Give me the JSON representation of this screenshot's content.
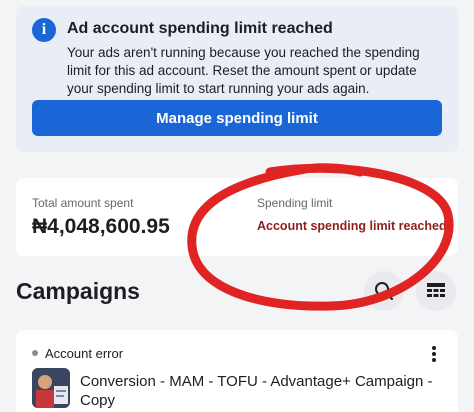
{
  "alert": {
    "title": "Ad account spending limit reached",
    "body": "Your ads aren't running because you reached the spending limit for this ad account. Reset the amount spent or update your spending limit to start running your ads again.",
    "button_label": "Manage spending limit",
    "icon": "info-icon",
    "accent_color": "#1b66d6"
  },
  "summary": {
    "total_label": "Total amount spent",
    "total_value": "₦4,048,600.95",
    "limit_label": "Spending limit",
    "limit_value": "Account spending limit reached",
    "limit_value_color": "#8e1e1e"
  },
  "annotation": {
    "type": "hand-drawn red circle around spending limit",
    "color": "#e02424"
  },
  "campaigns": {
    "heading": "Campaigns",
    "search_icon": "search-icon",
    "view_icon": "table-view-icon",
    "items": [
      {
        "status": "Account error",
        "name": "Conversion - MAM - TOFU - Advantage+ Campaign - Copy",
        "menu_icon": "more-vertical-icon"
      }
    ]
  }
}
